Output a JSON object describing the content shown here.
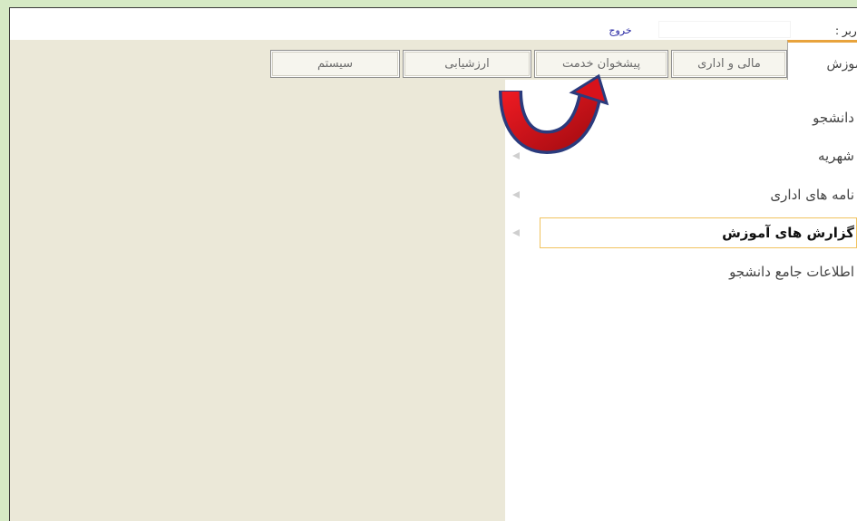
{
  "header": {
    "user_label": "کاربر :",
    "logout_label": "خروج"
  },
  "tabs": [
    {
      "label": "آموزش",
      "selected": true
    },
    {
      "label": "مالی و اداری",
      "selected": false
    },
    {
      "label": "پیشخوان خدمت",
      "selected": false
    },
    {
      "label": "ارزشیابی",
      "selected": false
    },
    {
      "label": "سیستم",
      "selected": false
    }
  ],
  "menu": {
    "items": [
      {
        "label": "دانشجو",
        "has_submenu": false,
        "highlighted": false
      },
      {
        "label": "شهریه",
        "has_submenu": true,
        "highlighted": false
      },
      {
        "label": "نامه های اداری",
        "has_submenu": true,
        "highlighted": false
      },
      {
        "label": "گزارش های آموزش",
        "has_submenu": true,
        "highlighted": true
      },
      {
        "label": "اطلاعات جامع دانشجو",
        "has_submenu": false,
        "highlighted": false
      }
    ]
  },
  "icons": {
    "submenu_indicator": "triangle-left-icon",
    "annotation": "u-turn-arrow-icon"
  },
  "colors": {
    "frame": "#d6eac5",
    "panel": "#ebe8d8",
    "selected_tab_accent": "#e8a33c",
    "highlight_border": "#f1c35f",
    "link": "#2626a3",
    "annotation_arrow_fill": "#d8121b",
    "annotation_arrow_outline": "#2a3b7d"
  }
}
